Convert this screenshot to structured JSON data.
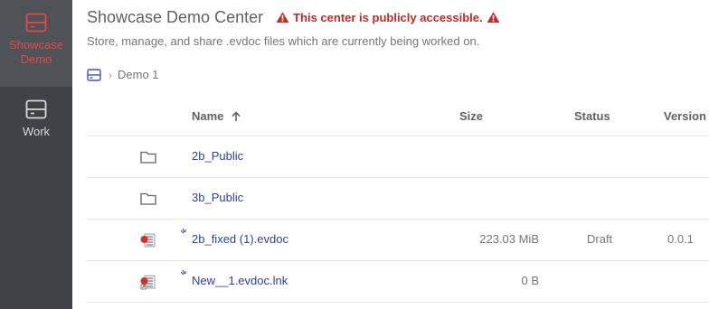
{
  "sidebar": {
    "items": [
      {
        "label": "Showcase Demo",
        "icon": "server-icon",
        "active": true
      },
      {
        "label": "Work",
        "icon": "server-icon",
        "active": false
      }
    ]
  },
  "header": {
    "title": "Showcase Demo Center",
    "warning": "This center is publicly accessible.",
    "subtitle": "Store, manage, and share .evdoc files which are currently being worked on."
  },
  "breadcrumb": {
    "home_icon": "server-icon",
    "separator_icon": "chevron-right-icon",
    "current": "Demo 1"
  },
  "table": {
    "columns": {
      "name": "Name",
      "size": "Size",
      "status": "Status",
      "version": "Version"
    },
    "sort_icon": "arrow-up-icon",
    "rows": [
      {
        "icon": "folder-icon",
        "name": "2b_Public",
        "size": "",
        "status": "",
        "version": ""
      },
      {
        "icon": "folder-icon",
        "name": "3b_Public",
        "size": "",
        "status": "",
        "version": ""
      },
      {
        "icon": "evdoc-file-icon",
        "name": "2b_fixed (1).evdoc",
        "size": "223.03 MiB",
        "status": "Draft",
        "version": "0.0.1"
      },
      {
        "icon": "evdoc-link-icon",
        "name": "New__1.evdoc.lnk",
        "size": "0 B",
        "status": "",
        "version": ""
      }
    ]
  },
  "colors": {
    "sidebar_bg": "#3f4347",
    "sidebar_active_bg": "#4f5357",
    "accent_red": "#e04a4a",
    "warning_red": "#c62828",
    "link_blue": "#303f9f"
  }
}
